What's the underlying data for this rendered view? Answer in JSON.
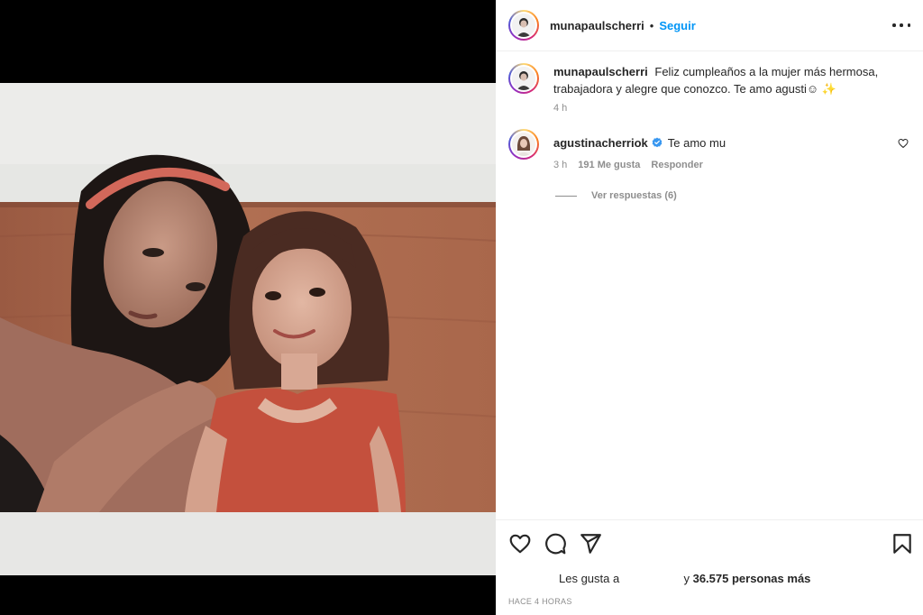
{
  "post": {
    "username": "munapaulscherri",
    "separator": "•",
    "follow_label": "Seguir",
    "more_icon": "more-horizontal-icon"
  },
  "caption": {
    "username": "munapaulscherri",
    "text": "Feliz cumpleaños a la mujer más hermosa, trabajadora y alegre que conozco. Te amo agusti☺ ✨",
    "time": "4 h"
  },
  "comments": [
    {
      "username": "agustinacherriok",
      "verified": true,
      "text": "Te amo mu",
      "time": "3 h",
      "likes": "191 Me gusta",
      "reply_label": "Responder",
      "view_replies": "Ver respuestas (6)"
    }
  ],
  "actions": {
    "likes_prefix": "Les gusta a",
    "likes_suffix": "y",
    "likes_count": "36.575 personas más",
    "timestamp": "Hace 4 horas"
  },
  "colors": {
    "accent": "#0095f6",
    "secondary_text": "#8e8e8e",
    "verified": "#3897f0"
  }
}
